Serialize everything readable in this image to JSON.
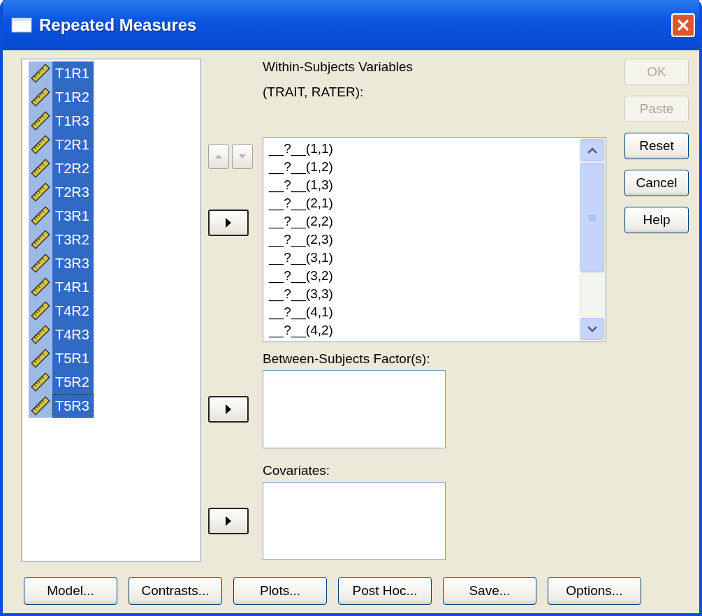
{
  "window": {
    "title": "Repeated Measures"
  },
  "variables": [
    {
      "name": "T1R1",
      "selected": true,
      "focused": false
    },
    {
      "name": "T1R2",
      "selected": true,
      "focused": false
    },
    {
      "name": "T1R3",
      "selected": true,
      "focused": false
    },
    {
      "name": "T2R1",
      "selected": true,
      "focused": false
    },
    {
      "name": "T2R2",
      "selected": true,
      "focused": false
    },
    {
      "name": "T2R3",
      "selected": true,
      "focused": false
    },
    {
      "name": "T3R1",
      "selected": true,
      "focused": false
    },
    {
      "name": "T3R2",
      "selected": true,
      "focused": false
    },
    {
      "name": "T3R3",
      "selected": true,
      "focused": false
    },
    {
      "name": "T4R1",
      "selected": true,
      "focused": false
    },
    {
      "name": "T4R2",
      "selected": true,
      "focused": false
    },
    {
      "name": "T4R3",
      "selected": true,
      "focused": false
    },
    {
      "name": "T5R1",
      "selected": true,
      "focused": false
    },
    {
      "name": "T5R2",
      "selected": true,
      "focused": false
    },
    {
      "name": "T5R3",
      "selected": true,
      "focused": true
    }
  ],
  "within": {
    "label": "Within-Subjects Variables",
    "factors": "(TRAIT, RATER):",
    "order_buttons_disabled": true,
    "items": [
      "__?__(1,1)",
      "__?__(1,2)",
      "__?__(1,3)",
      "__?__(2,1)",
      "__?__(2,2)",
      "__?__(2,3)",
      "__?__(3,1)",
      "__?__(3,2)",
      "__?__(3,3)",
      "__?__(4,1)",
      "__?__(4,2)"
    ]
  },
  "between": {
    "label": "Between-Subjects Factor(s):"
  },
  "covariates": {
    "label": "Covariates:"
  },
  "side_buttons": [
    {
      "label": "OK",
      "disabled": true
    },
    {
      "label": "Paste",
      "disabled": true
    },
    {
      "label": "Reset",
      "disabled": false
    },
    {
      "label": "Cancel",
      "disabled": false
    },
    {
      "label": "Help",
      "disabled": false
    }
  ],
  "bottom_buttons": [
    "Model...",
    "Contrasts...",
    "Plots...",
    "Post Hoc...",
    "Save...",
    "Options..."
  ]
}
